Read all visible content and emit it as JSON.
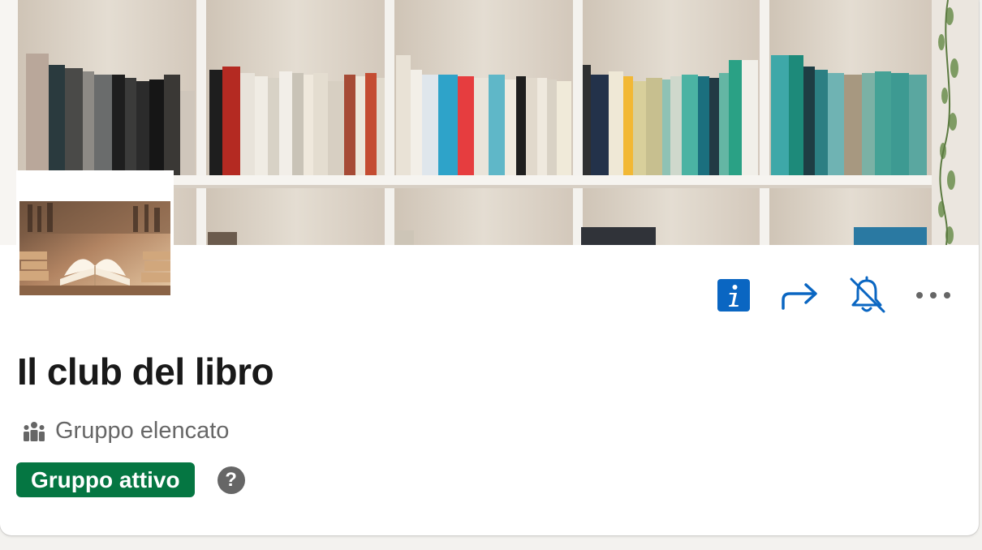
{
  "group": {
    "name": "Il club del libro",
    "type_label": "Gruppo elencato",
    "status_badge": "Gruppo attivo",
    "help_symbol": "?"
  },
  "actions": [
    {
      "name": "info-icon",
      "label": "Informazioni"
    },
    {
      "name": "share-icon",
      "label": "Condividi"
    },
    {
      "name": "notifications-off-icon",
      "label": "Notifiche disattivate"
    },
    {
      "name": "more-icon",
      "label": "Altro"
    }
  ],
  "icons": {
    "group_type": "people-group-icon",
    "help": "question-icon"
  },
  "colors": {
    "brand_blue": "#0a66c2",
    "active_green": "#057642",
    "text_primary": "#191919",
    "text_secondary": "#666666",
    "help_gray": "#666666"
  }
}
